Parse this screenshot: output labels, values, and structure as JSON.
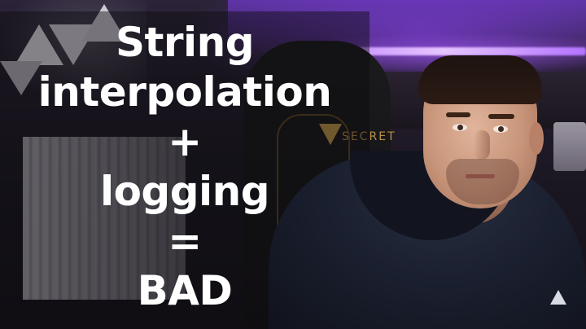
{
  "thumbnail": {
    "title_lines": [
      "String",
      "interpolation",
      "+",
      "logging",
      "=",
      "BAD"
    ],
    "chair_brand": "SECRET"
  },
  "colors": {
    "title_text": "#ffffff",
    "accent_glow": "#b372ff",
    "hoodie": "#1b2030"
  }
}
